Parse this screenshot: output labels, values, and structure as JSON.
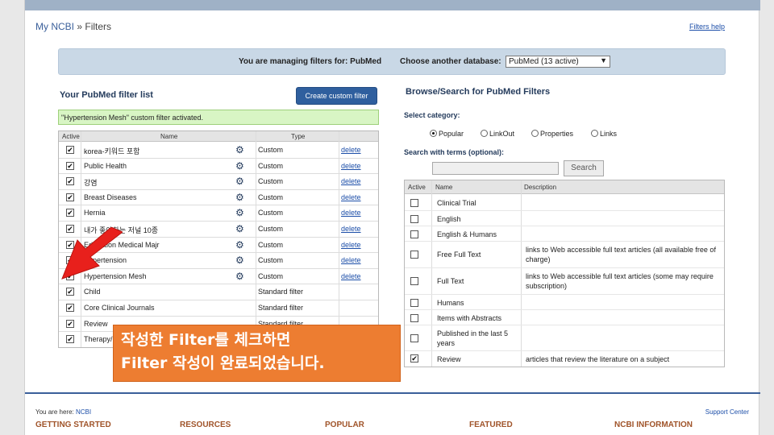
{
  "breadcrumb": {
    "root": "My NCBI",
    "separator": "»",
    "current": "Filters"
  },
  "help_link": "Filters help",
  "banner": {
    "managing_label": "You are managing filters for: PubMed",
    "choose_label": "Choose another database:",
    "database_select": "PubMed (13 active)"
  },
  "left": {
    "title": "Your PubMed filter list",
    "create_button": "Create custom filter",
    "notice": "\"Hypertension Mesh\" custom filter activated.",
    "headers": {
      "active": "Active",
      "name": "Name",
      "type": "Type"
    },
    "rows": [
      {
        "name": "korea-키워드 포함",
        "type": "Custom",
        "action": "delete",
        "checked": "✔"
      },
      {
        "name": "Public Health",
        "type": "Custom",
        "action": "delete",
        "checked": "✔"
      },
      {
        "name": "강염",
        "type": "Custom",
        "action": "delete",
        "checked": "✔"
      },
      {
        "name": "Breast Diseases",
        "type": "Custom",
        "action": "delete",
        "checked": "✔"
      },
      {
        "name": "Hernia",
        "type": "Custom",
        "action": "delete",
        "checked": "✔"
      },
      {
        "name": "내가 좋아하는 저널 10종",
        "type": "Custom",
        "action": "delete",
        "checked": "✔"
      },
      {
        "name": "Education Medical Majr",
        "type": "Custom",
        "action": "delete",
        "checked": "✔"
      },
      {
        "name": "Hypertension",
        "type": "Custom",
        "action": "delete",
        "checked": "✔"
      },
      {
        "name": "Hypertension Mesh",
        "type": "Custom",
        "action": "delete",
        "checked": "✔"
      },
      {
        "name": "Child",
        "type": "Standard filter",
        "action": "",
        "checked": "✔"
      },
      {
        "name": "Core Clinical Journals",
        "type": "Standard filter",
        "action": "",
        "checked": "✔"
      },
      {
        "name": "Review",
        "type": "Standard filter",
        "action": "",
        "checked": "✔"
      },
      {
        "name": "Therapy/Narrow",
        "type": "Standard filter",
        "action": "",
        "checked": "✔"
      }
    ]
  },
  "right": {
    "title": "Browse/Search for PubMed Filters",
    "category_label": "Select category:",
    "categories": [
      "Popular",
      "LinkOut",
      "Properties",
      "Links"
    ],
    "selected_category": "Popular",
    "search_label": "Search with terms (optional):",
    "search_button": "Search",
    "headers": {
      "active": "Active",
      "name": "Name",
      "description": "Description"
    },
    "rows": [
      {
        "name": "Clinical Trial",
        "description": "",
        "checked": ""
      },
      {
        "name": "English",
        "description": "",
        "checked": ""
      },
      {
        "name": "English & Humans",
        "description": "",
        "checked": ""
      },
      {
        "name": "Free Full Text",
        "description": "links to Web accessible full text articles (all available free of charge)",
        "checked": ""
      },
      {
        "name": "Full Text",
        "description": "links to Web accessible full text articles (some may require subscription)",
        "checked": ""
      },
      {
        "name": "Humans",
        "description": "",
        "checked": ""
      },
      {
        "name": "Items with Abstracts",
        "description": "",
        "checked": ""
      },
      {
        "name": "Published in the last 5 years",
        "description": "",
        "checked": ""
      },
      {
        "name": "Review",
        "description": "articles that review the literature on a subject",
        "checked": "✔"
      }
    ]
  },
  "callout": {
    "line1": "작성한 Filter를 체크하면",
    "line2": "Filter 작성이 완료되었습니다."
  },
  "footer": {
    "here_label": "You are here:",
    "here_link": "NCBI",
    "support": "Support Center",
    "columns": [
      "GETTING STARTED",
      "RESOURCES",
      "POPULAR",
      "FEATURED",
      "NCBI INFORMATION"
    ]
  },
  "colors": {
    "accent": "#2f5f9e",
    "callout": "#ed7d31",
    "arrow": "#e8201c",
    "notice": "#d8f5c4"
  }
}
